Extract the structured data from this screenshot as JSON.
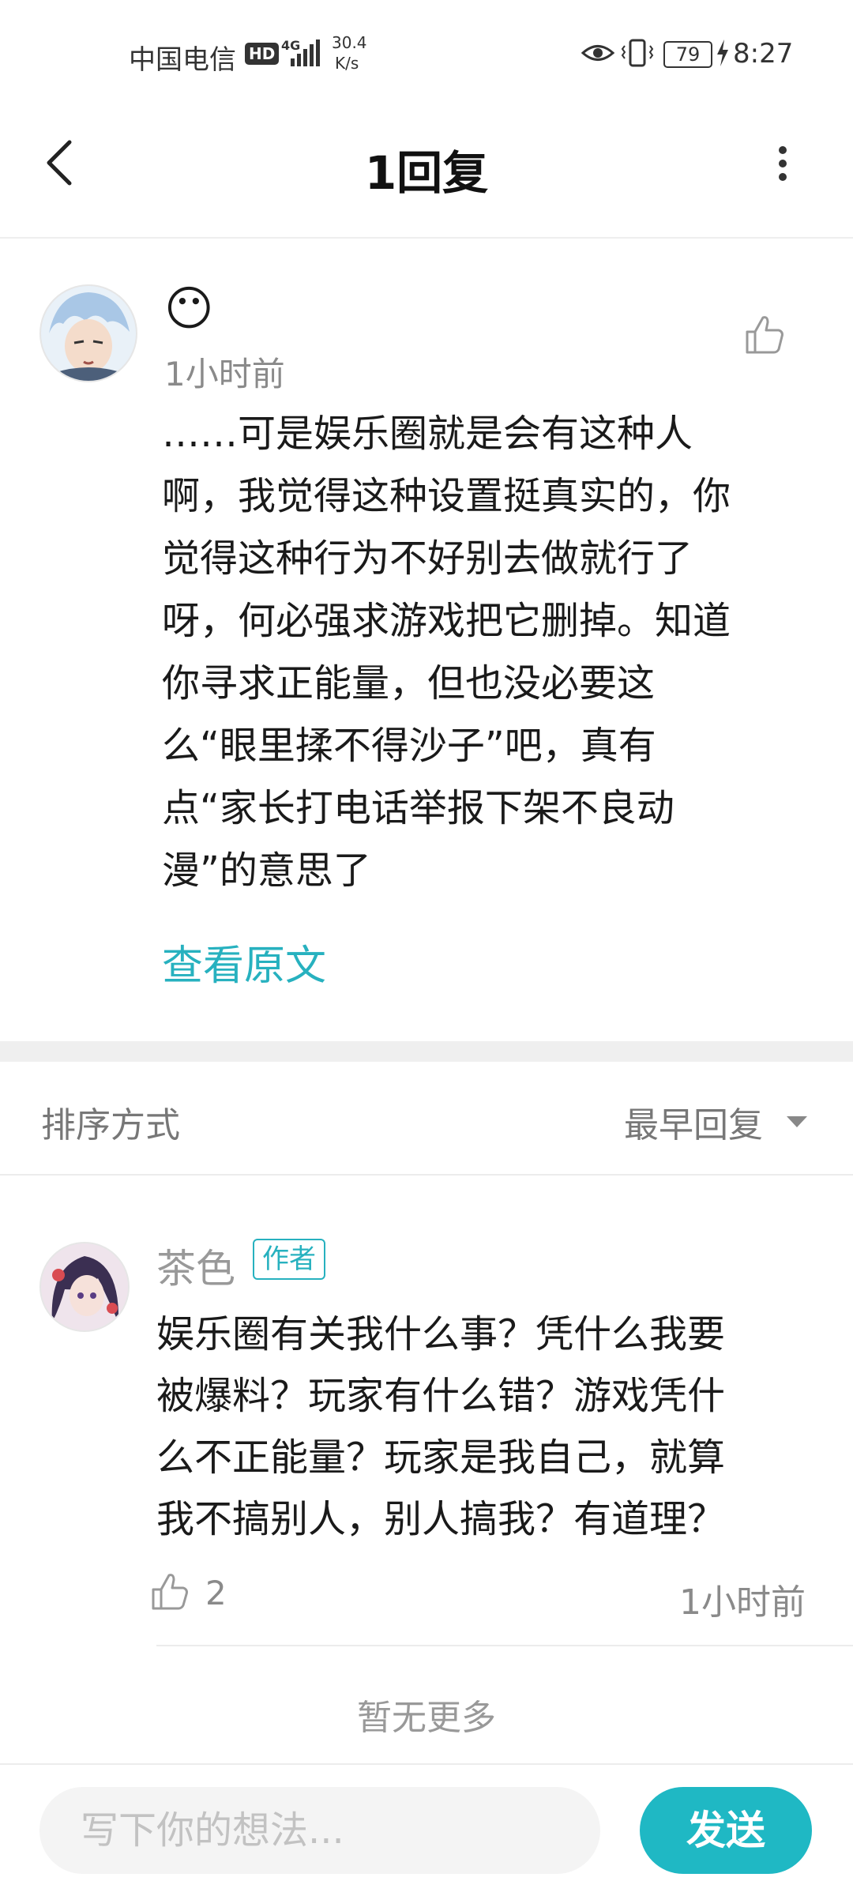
{
  "status_bar": {
    "carrier": "中国电信",
    "hd": "HD",
    "network": "4G",
    "speed_value": "30.4",
    "speed_unit": "K/s",
    "battery": "79",
    "time": "8:27"
  },
  "header": {
    "title": "1回复"
  },
  "main_comment": {
    "emoji": "😶",
    "time": "1小时前",
    "text": "……可是娱乐圈就是会有这种人\n啊，我觉得这种设置挺真实的，你\n觉得这种行为不好别去做就行了\n呀，何必强求游戏把它删掉。知道\n你寻求正能量，但也没必要这\n么“眼里揉不得沙子”吧，真有\n点“家长打电话举报下架不良动\n漫”的意思了",
    "view_original": "查看原文"
  },
  "sort": {
    "label": "排序方式",
    "value": "最早回复"
  },
  "reply": {
    "username": "茶色",
    "badge": "作者",
    "text": "娱乐圈有关我什么事？凭什么我要\n被爆料？玩家有什么错？游戏凭什\n么不正能量？玩家是我自己，就算\n我不搞别人，别人搞我？有道理？",
    "likes": "2",
    "time": "1小时前"
  },
  "footer_note": "暂无更多",
  "composer": {
    "placeholder": "写下你的想法...",
    "send_label": "发送"
  },
  "colors": {
    "accent": "#27b1bf",
    "send_button": "#1fb8c4"
  }
}
